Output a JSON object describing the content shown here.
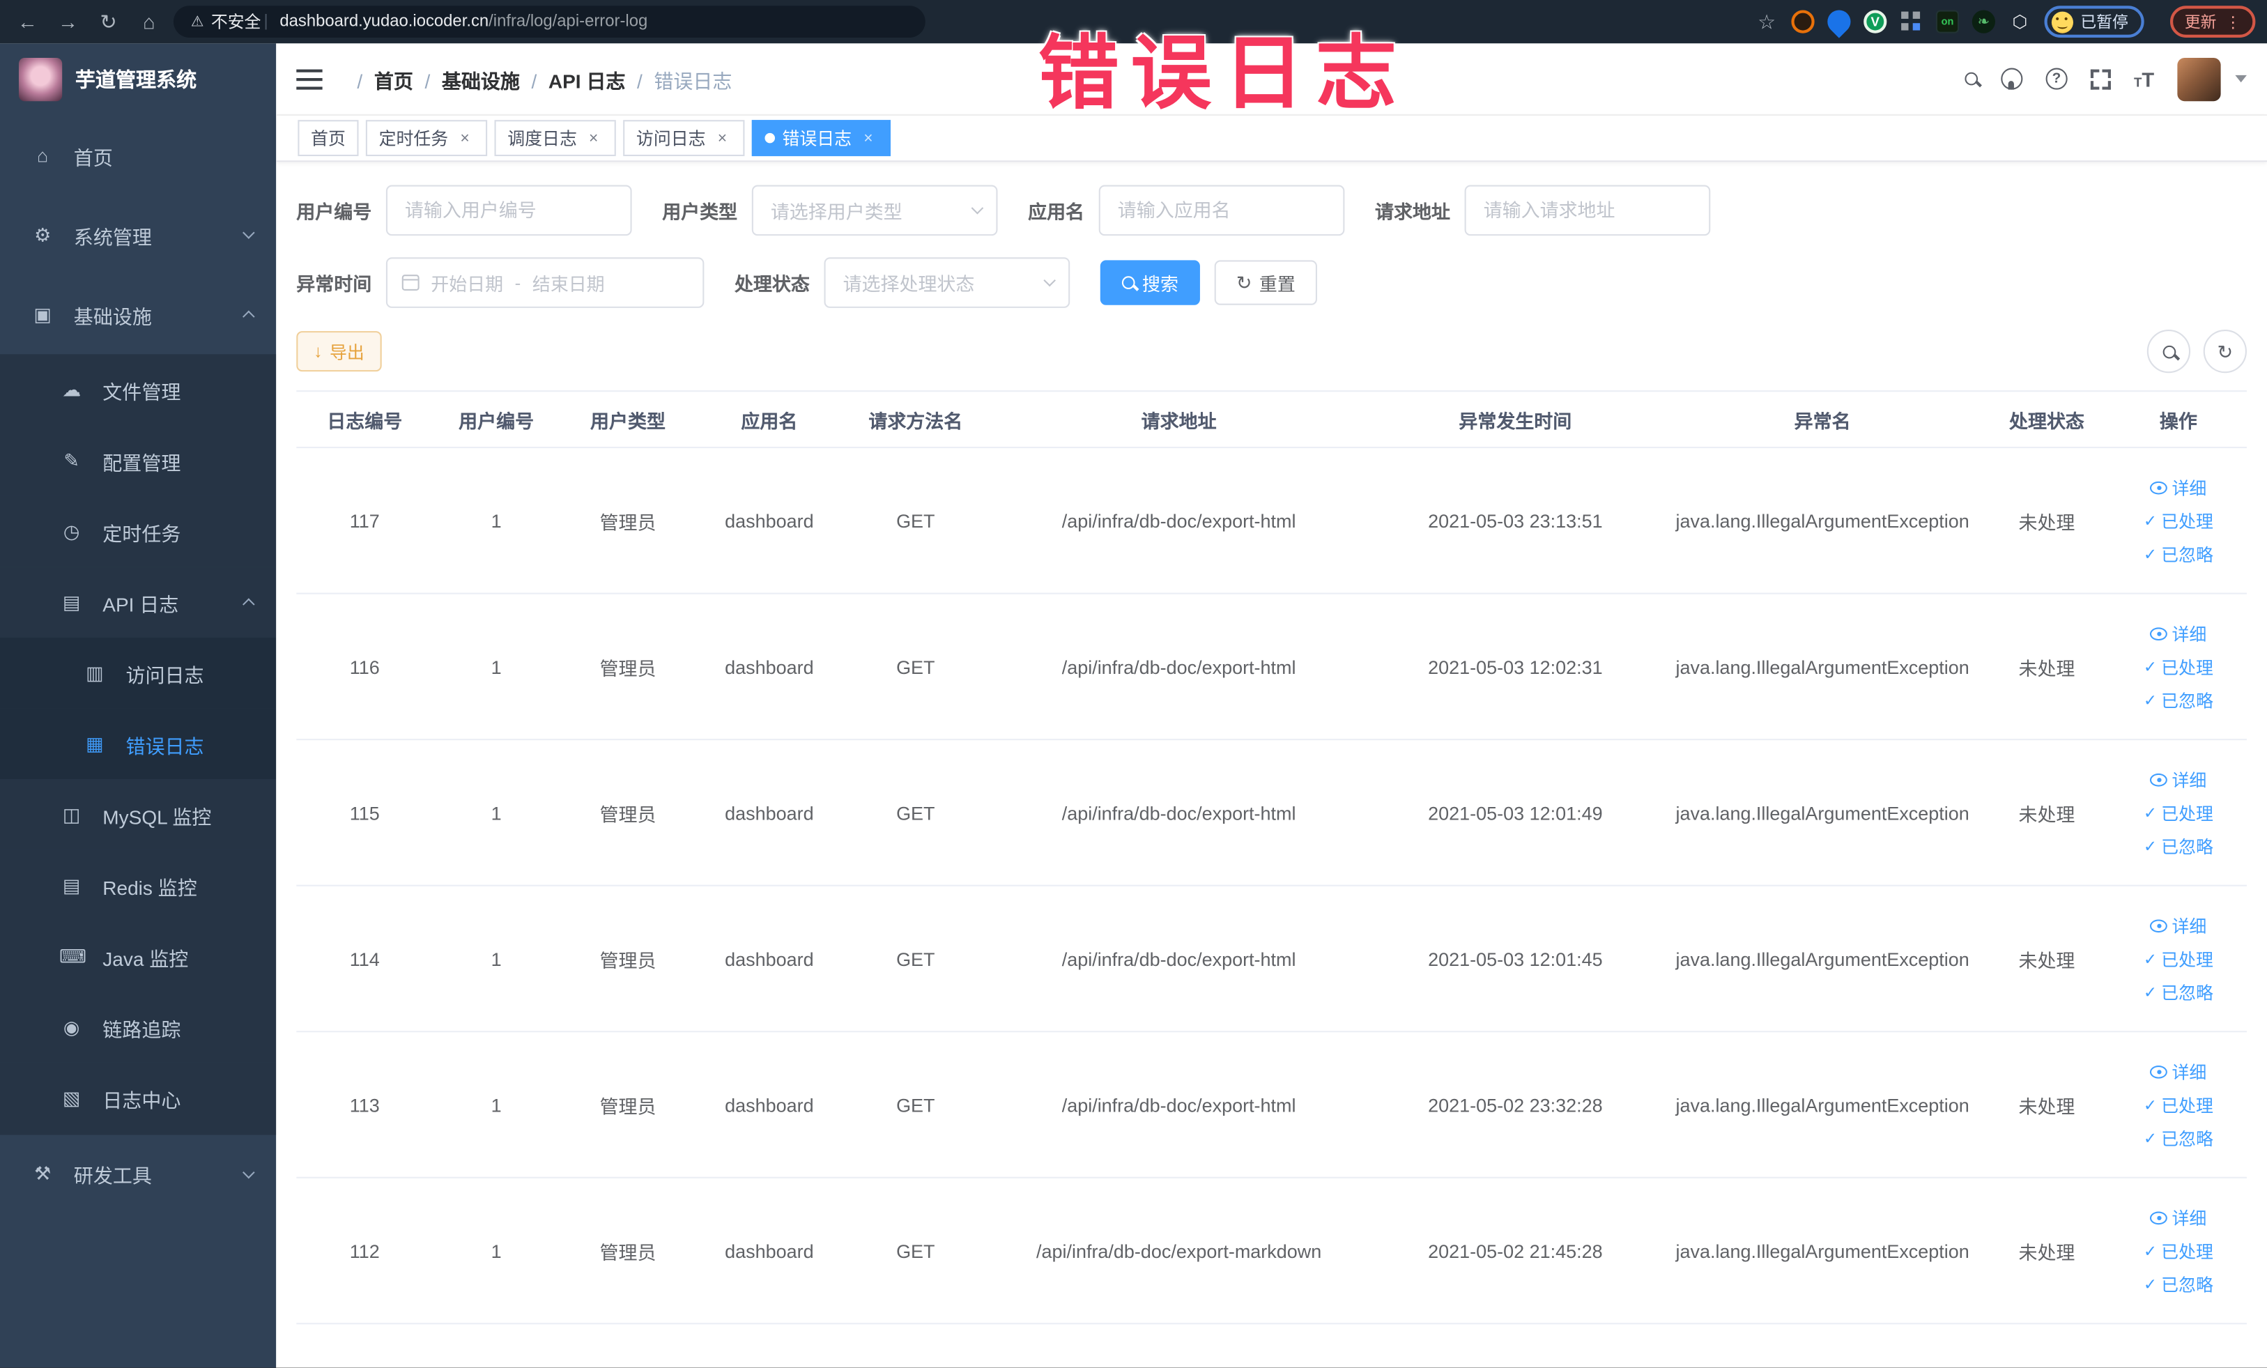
{
  "annotation": {
    "text": "错误日志"
  },
  "browser": {
    "security": "不安全",
    "url_domain": "dashboard.yudao.iocoder.cn",
    "url_path": "/infra/log/api-error-log",
    "profile_status": "已暂停",
    "update_label": "更新"
  },
  "sidebar": {
    "title": "芋道管理系统",
    "items": [
      {
        "label": "首页",
        "glyph": "⌂",
        "icon": "home-icon",
        "level": "l1"
      },
      {
        "label": "系统管理",
        "glyph": "⚙",
        "icon": "gear-icon",
        "level": "l1",
        "caret_down": true
      },
      {
        "label": "基础设施",
        "glyph": "▣",
        "icon": "infrastructure-icon",
        "level": "l1",
        "caret_up": true
      },
      {
        "label": "文件管理",
        "glyph": "☁",
        "icon": "file-manage-icon",
        "level": "l2"
      },
      {
        "label": "配置管理",
        "glyph": "✎",
        "icon": "config-manage-icon",
        "level": "l2"
      },
      {
        "label": "定时任务",
        "glyph": "◷",
        "icon": "scheduled-task-icon",
        "level": "l2"
      },
      {
        "label": "API 日志",
        "glyph": "▤",
        "icon": "api-log-icon",
        "level": "l2",
        "caret_up": true
      },
      {
        "label": "访问日志",
        "glyph": "▥",
        "icon": "access-log-icon",
        "level": "l3"
      },
      {
        "label": "错误日志",
        "glyph": "▦",
        "icon": "error-log-icon",
        "level": "l3",
        "state": "active"
      },
      {
        "label": "MySQL 监控",
        "glyph": "◫",
        "icon": "mysql-monitor-icon",
        "level": "l2"
      },
      {
        "label": "Redis 监控",
        "glyph": "▤",
        "icon": "redis-monitor-icon",
        "level": "l2"
      },
      {
        "label": "Java 监控",
        "glyph": "⌨",
        "icon": "java-monitor-icon",
        "level": "l2"
      },
      {
        "label": "链路追踪",
        "glyph": "◉",
        "icon": "trace-icon",
        "level": "l2"
      },
      {
        "label": "日志中心",
        "glyph": "▧",
        "icon": "log-center-icon",
        "level": "l2"
      },
      {
        "label": "研发工具",
        "glyph": "⚒",
        "icon": "devtools-icon",
        "level": "l1 section",
        "caret_down": true
      }
    ]
  },
  "breadcrumb": [
    {
      "label": "首页"
    },
    {
      "label": "基础设施"
    },
    {
      "label": "API 日志"
    },
    {
      "label": "错误日志",
      "state": "current"
    }
  ],
  "tabs": [
    {
      "label": "首页"
    },
    {
      "label": "定时任务",
      "closable": true
    },
    {
      "label": "调度日志",
      "closable": true
    },
    {
      "label": "访问日志",
      "closable": true
    },
    {
      "label": "错误日志",
      "closable": true,
      "dot": true,
      "state": "active"
    }
  ],
  "filters": {
    "user_no": {
      "label": "用户编号",
      "placeholder": "请输入用户编号"
    },
    "user_type": {
      "label": "用户类型",
      "placeholder": "请选择用户类型"
    },
    "app_name": {
      "label": "应用名",
      "placeholder": "请输入应用名"
    },
    "request_url": {
      "label": "请求地址",
      "placeholder": "请输入请求地址"
    },
    "time": {
      "label": "异常时间",
      "start_placeholder": "开始日期",
      "separator": "-",
      "end_placeholder": "结束日期"
    },
    "status": {
      "label": "处理状态",
      "placeholder": "请选择处理状态"
    },
    "search_label": "搜索",
    "reset_label": "重置"
  },
  "toolbar": {
    "export_label": "导出"
  },
  "table": {
    "columns": [
      {
        "label": "日志编号",
        "cls": "c1"
      },
      {
        "label": "用户编号",
        "cls": "c2"
      },
      {
        "label": "用户类型",
        "cls": "c3"
      },
      {
        "label": "应用名",
        "cls": "c4"
      },
      {
        "label": "请求方法名",
        "cls": "c5"
      },
      {
        "label": "请求地址",
        "cls": "c6"
      },
      {
        "label": "异常发生时间",
        "cls": "c7"
      },
      {
        "label": "异常名",
        "cls": "c8"
      },
      {
        "label": "处理状态",
        "cls": "c9"
      },
      {
        "label": "操作",
        "cls": "c10"
      }
    ],
    "actions": [
      {
        "label": "详细"
      },
      {
        "label": "已处理"
      },
      {
        "label": "已忽略"
      }
    ],
    "rows": [
      {
        "id": "117",
        "user_id": "1",
        "user_type": "管理员",
        "app": "dashboard",
        "method": "GET",
        "url": "/api/infra/db-doc/export-html",
        "time": "2021-05-03 23:13:51",
        "exception": "java.lang.IllegalArgumentException",
        "status": "未处理"
      },
      {
        "id": "116",
        "user_id": "1",
        "user_type": "管理员",
        "app": "dashboard",
        "method": "GET",
        "url": "/api/infra/db-doc/export-html",
        "time": "2021-05-03 12:02:31",
        "exception": "java.lang.IllegalArgumentException",
        "status": "未处理"
      },
      {
        "id": "115",
        "user_id": "1",
        "user_type": "管理员",
        "app": "dashboard",
        "method": "GET",
        "url": "/api/infra/db-doc/export-html",
        "time": "2021-05-03 12:01:49",
        "exception": "java.lang.IllegalArgumentException",
        "status": "未处理"
      },
      {
        "id": "114",
        "user_id": "1",
        "user_type": "管理员",
        "app": "dashboard",
        "method": "GET",
        "url": "/api/infra/db-doc/export-html",
        "time": "2021-05-03 12:01:45",
        "exception": "java.lang.IllegalArgumentException",
        "status": "未处理"
      },
      {
        "id": "113",
        "user_id": "1",
        "user_type": "管理员",
        "app": "dashboard",
        "method": "GET",
        "url": "/api/infra/db-doc/export-html",
        "time": "2021-05-02 23:32:28",
        "exception": "java.lang.IllegalArgumentException",
        "status": "未处理"
      },
      {
        "id": "112",
        "user_id": "1",
        "user_type": "管理员",
        "app": "dashboard",
        "method": "GET",
        "url": "/api/infra/db-doc/export-markdown",
        "time": "2021-05-02 21:45:28",
        "exception": "java.lang.IllegalArgumentException",
        "status": "未处理"
      }
    ]
  }
}
